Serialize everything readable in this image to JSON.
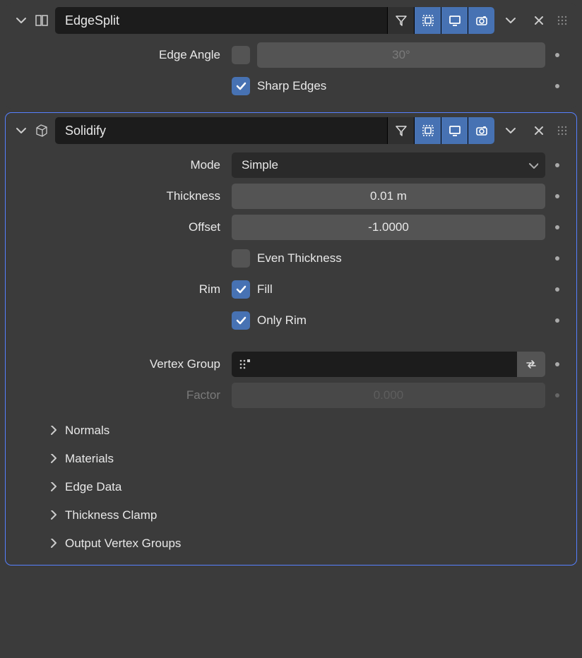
{
  "modifiers": [
    {
      "name": "EdgeSplit",
      "type": "edge-split",
      "display": {
        "edit": false,
        "cage": true,
        "viewport": true,
        "render": true
      },
      "edge_angle": {
        "label": "Edge Angle",
        "enabled": false,
        "value": "30°"
      },
      "sharp_edges": {
        "label": "Sharp Edges",
        "checked": true
      }
    },
    {
      "name": "Solidify",
      "type": "solidify",
      "display": {
        "edit": false,
        "cage": true,
        "viewport": true,
        "render": true
      },
      "mode": {
        "label": "Mode",
        "value": "Simple"
      },
      "thickness": {
        "label": "Thickness",
        "value": "0.01 m"
      },
      "offset": {
        "label": "Offset",
        "value": "-1.0000"
      },
      "even": {
        "label": "Even Thickness",
        "checked": false
      },
      "rim": {
        "label": "Rim",
        "fill": {
          "label": "Fill",
          "checked": true
        },
        "only": {
          "label": "Only Rim",
          "checked": true
        }
      },
      "vgroup": {
        "label": "Vertex Group",
        "value": ""
      },
      "factor": {
        "label": "Factor",
        "value": "0.000",
        "enabled": false
      },
      "subpanels": [
        "Normals",
        "Materials",
        "Edge Data",
        "Thickness Clamp",
        "Output Vertex Groups"
      ]
    }
  ]
}
